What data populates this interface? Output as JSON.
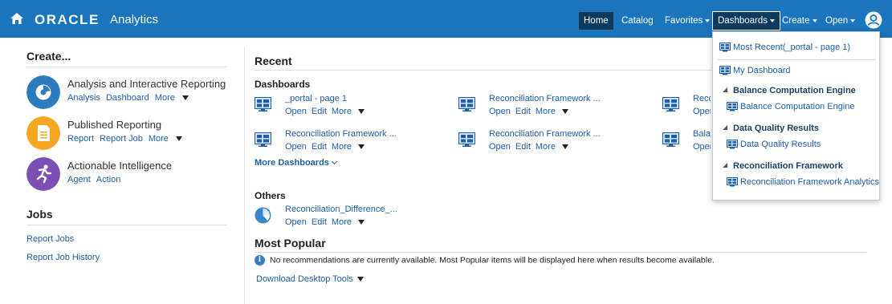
{
  "header": {
    "brand": "ORACLE",
    "product": "Analytics",
    "nav": {
      "home": "Home",
      "catalog": "Catalog",
      "favorites": "Favorites",
      "dashboards": "Dashboards",
      "create": "Create",
      "open": "Open"
    },
    "brand_color": "#1b75bc"
  },
  "create_section": {
    "title": "Create...",
    "items": [
      {
        "title": "Analysis and Interactive Reporting",
        "links": [
          "Analysis",
          "Dashboard",
          "More"
        ],
        "icon": "analysis-icon",
        "color": "#2b7bbf"
      },
      {
        "title": "Published Reporting",
        "links": [
          "Report",
          "Report Job",
          "More"
        ],
        "icon": "document-icon",
        "color": "#f6a623"
      },
      {
        "title": "Actionable Intelligence",
        "links": [
          "Agent",
          "Action"
        ],
        "icon": "agent-runner-icon",
        "color": "#7b4fb3"
      }
    ]
  },
  "jobs": {
    "title": "Jobs",
    "links": [
      "Report Jobs",
      "Report Job History"
    ]
  },
  "recent": {
    "title": "Recent",
    "dashboards_title": "Dashboards",
    "dashboards": [
      {
        "name": "_portal - page 1"
      },
      {
        "name": "Reconciliation Framework ..."
      },
      {
        "name": "Reco"
      },
      {
        "name": "Reconciliation Framework ..."
      },
      {
        "name": "Reconciliation Framework ..."
      },
      {
        "name": "Balan"
      }
    ],
    "actions": {
      "open": "Open",
      "edit": "Edit",
      "more": "More"
    },
    "more_dashboards": "More Dashboards",
    "others_title": "Others",
    "others": [
      {
        "name": "Reconciliation_Difference_..."
      }
    ]
  },
  "popular": {
    "title": "Most Popular",
    "message": "No recommendations are currently available. Most Popular items will be displayed here when results become available.",
    "download": "Download Desktop Tools"
  },
  "dropdown": {
    "most_recent": "Most Recent(_portal - page 1)",
    "my_dashboard": "My Dashboard",
    "groups": [
      {
        "title": "Balance Computation Engine",
        "item": "Balance Computation Engine"
      },
      {
        "title": "Data Quality Results",
        "item": "Data Quality Results"
      },
      {
        "title": "Reconciliation Framework",
        "item": "Reconciliation Framework Analytics"
      }
    ]
  }
}
